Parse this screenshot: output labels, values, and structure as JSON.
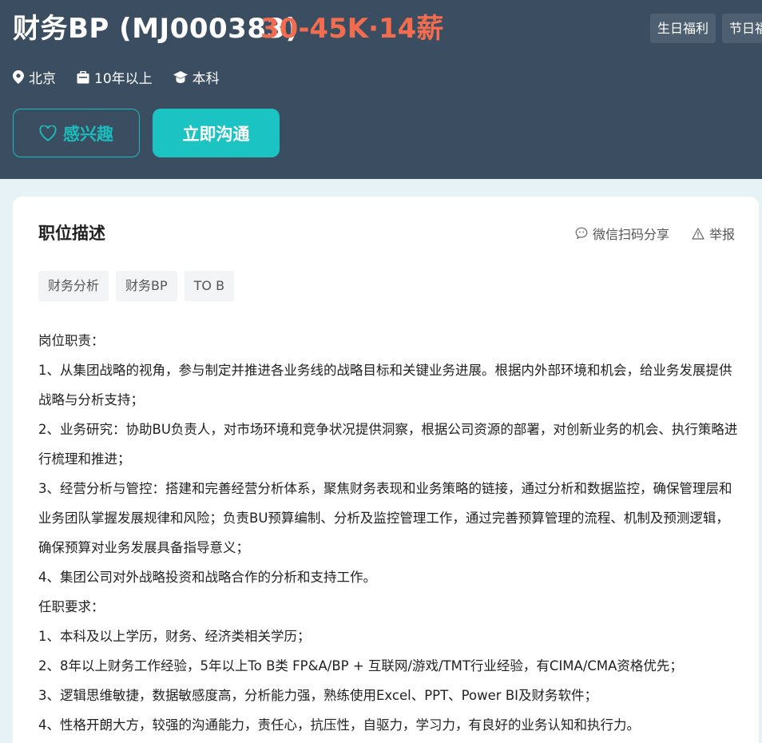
{
  "header": {
    "title": "财务BP (MJ000383)",
    "salary": "30-45K·14薪",
    "welfare": [
      "生日福利",
      "节日福利"
    ],
    "location": "北京",
    "experience": "10年以上",
    "education": "本科",
    "interest_label": "感兴趣",
    "chat_label": "立即沟通"
  },
  "colors": {
    "header_bg": "#3b4d60",
    "salary": "#f26d4f",
    "accent": "#1bc3c3"
  },
  "card": {
    "section_title": "职位描述",
    "share_label": "微信扫码分享",
    "report_label": "举报",
    "tags": [
      "财务分析",
      "财务BP",
      "TO B"
    ],
    "lines": [
      "岗位职责：",
      "1、从集团战略的视角，参与制定并推进各业务线的战略目标和关键业务进展。根据内外部环境和机会，给业务发展提供战略与分析支持；",
      "2、业务研究：协助BU负责人，对市场环境和竞争状况提供洞察，根据公司资源的部署，对创新业务的机会、执行策略进行梳理和推进；",
      "3、经营分析与管控：搭建和完善经营分析体系，聚焦财务表现和业务策略的链接，通过分析和数据监控，确保管理层和业务团队掌握发展规律和风险；负责BU预算编制、分析及监控管理工作，通过完善预算管理的流程、机制及预测逻辑，确保预算对业务发展具备指导意义；",
      "4、集团公司对外战略投资和战略合作的分析和支持工作。",
      "任职要求：",
      "1、本科及以上学历，财务、经济类相关学历；",
      "2、8年以上财务工作经验，5年以上To B类 FP&A/BP + 互联网/游戏/TMT行业经验，有CIMA/CMA资格优先；",
      "3、逻辑思维敏捷，数据敏感度高，分析能力强，熟练使用Excel、PPT、Power BI及财务软件；",
      "4、性格开朗大方，较强的沟通能力，责任心，抗压性，自驱力，学习力，有良好的业务认知和执行力。"
    ]
  }
}
